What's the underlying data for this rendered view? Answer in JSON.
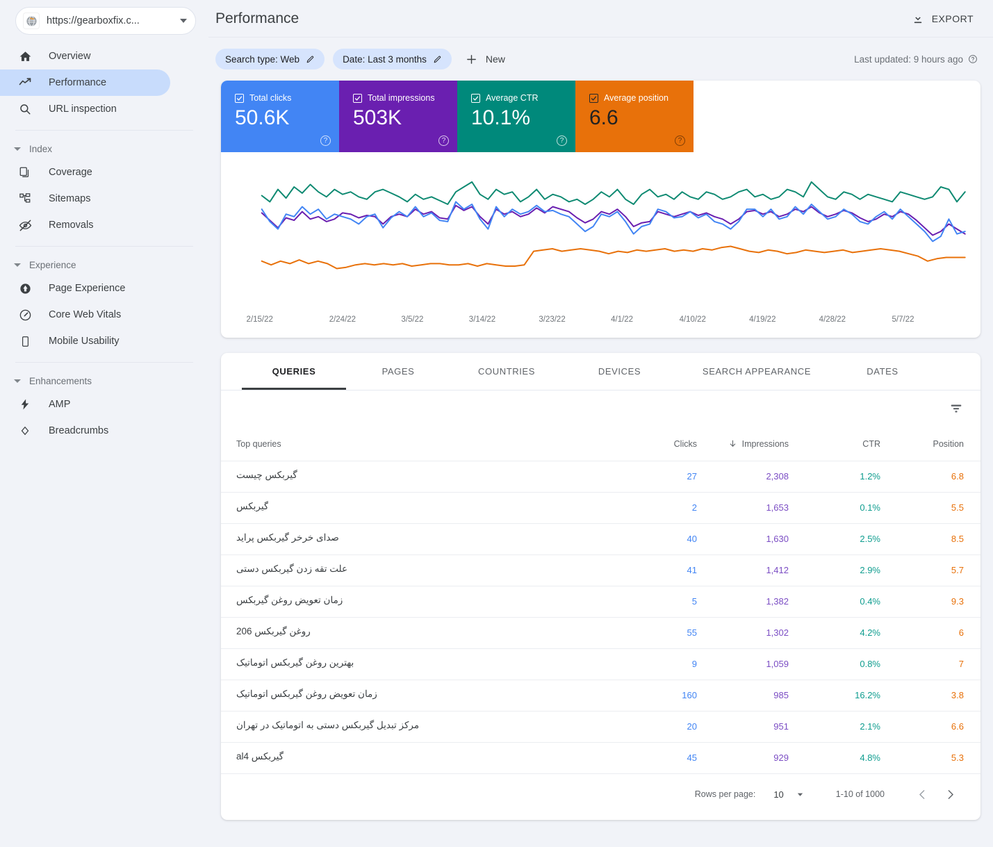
{
  "sidebar": {
    "property": {
      "url": "https://gearboxfix.c...",
      "favicon_icon": "site-favicon-icon",
      "dropdown_icon": "chevron-down-icon"
    },
    "items": [
      {
        "label": "Overview",
        "icon": "home-icon",
        "active": false
      },
      {
        "label": "Performance",
        "icon": "trending-up-icon",
        "active": true
      },
      {
        "label": "URL inspection",
        "icon": "search-icon",
        "active": false
      }
    ],
    "groups": [
      {
        "label": "Index",
        "icon": "triangle-down-icon",
        "items": [
          {
            "label": "Coverage",
            "icon": "pages-copy-icon"
          },
          {
            "label": "Sitemaps",
            "icon": "sitemap-icon"
          },
          {
            "label": "Removals",
            "icon": "eye-off-icon"
          }
        ]
      },
      {
        "label": "Experience",
        "icon": "triangle-down-icon",
        "items": [
          {
            "label": "Page Experience",
            "icon": "page-experience-icon"
          },
          {
            "label": "Core Web Vitals",
            "icon": "speedometer-icon"
          },
          {
            "label": "Mobile Usability",
            "icon": "mobile-phone-icon"
          }
        ]
      },
      {
        "label": "Enhancements",
        "icon": "triangle-down-icon",
        "items": [
          {
            "label": "AMP",
            "icon": "lightning-bolt-icon"
          },
          {
            "label": "Breadcrumbs",
            "icon": "breadcrumbs-icon"
          }
        ]
      }
    ]
  },
  "header": {
    "title": "Performance",
    "export_label": "EXPORT",
    "export_icon": "download-icon"
  },
  "filters": {
    "chips": [
      {
        "label": "Search type: Web",
        "icon": "pencil-icon"
      },
      {
        "label": "Date: Last 3 months",
        "icon": "pencil-icon"
      }
    ],
    "new_label": "New",
    "new_icon": "plus-icon",
    "last_updated": "Last updated: 9 hours ago",
    "help_icon": "help-circle-icon"
  },
  "metrics": [
    {
      "name": "Total clicks",
      "value": "50.6K",
      "color": "#4285F4",
      "checked": true,
      "dark_text": false,
      "help_icon": "help-circle-icon",
      "checkbox_icon": "checkbox-checked-icon"
    },
    {
      "name": "Total impressions",
      "value": "503K",
      "color": "#6A1FB0",
      "checked": true,
      "dark_text": false,
      "help_icon": "help-circle-icon",
      "checkbox_icon": "checkbox-checked-icon"
    },
    {
      "name": "Average CTR",
      "value": "10.1%",
      "color": "#00897B",
      "checked": true,
      "dark_text": false,
      "help_icon": "help-circle-icon",
      "checkbox_icon": "checkbox-checked-icon"
    },
    {
      "name": "Average position",
      "value": "6.6",
      "color": "#E8710A",
      "checked": true,
      "dark_text": true,
      "help_icon": "help-circle-icon",
      "checkbox_icon": "checkbox-checked-icon"
    }
  ],
  "chart_data": {
    "type": "line",
    "title": "",
    "xlabel": "",
    "ylabel": "",
    "grid": false,
    "legend": "metric-cards-above",
    "tick_labels": [
      "2/15/22",
      "2/24/22",
      "3/5/22",
      "3/14/22",
      "3/23/22",
      "4/1/22",
      "4/10/22",
      "4/19/22",
      "4/28/22",
      "5/7/22"
    ],
    "tick_positions_pct": [
      5.1,
      16.0,
      25.2,
      34.4,
      43.6,
      52.8,
      62.1,
      71.3,
      80.5,
      89.8
    ],
    "series": [
      {
        "name": "Total impressions",
        "color": "#6A1FB0",
        "values": [
          61,
          55,
          49,
          57,
          55,
          62,
          56,
          58,
          54,
          56,
          61,
          60,
          57,
          59,
          58,
          52,
          58,
          60,
          58,
          64,
          60,
          62,
          57,
          56,
          67,
          63,
          66,
          58,
          52,
          64,
          60,
          62,
          58,
          60,
          65,
          61,
          66,
          64,
          62,
          57,
          53,
          56,
          62,
          60,
          64,
          58,
          50,
          53,
          54,
          62,
          60,
          58,
          60,
          62,
          59,
          61,
          58,
          56,
          52,
          56,
          62,
          63,
          60,
          62,
          58,
          60,
          64,
          62,
          66,
          61,
          58,
          60,
          63,
          61,
          57,
          54,
          56,
          60,
          58,
          62,
          60,
          55,
          49,
          43,
          46,
          52,
          48,
          44
        ]
      },
      {
        "name": "Total clicks",
        "color": "#4285F4",
        "values": [
          64,
          54,
          48,
          60,
          58,
          66,
          60,
          64,
          56,
          60,
          58,
          56,
          52,
          58,
          60,
          49,
          57,
          62,
          58,
          66,
          58,
          61,
          55,
          54,
          70,
          64,
          68,
          56,
          48,
          66,
          58,
          64,
          60,
          62,
          67,
          62,
          63,
          60,
          58,
          52,
          46,
          50,
          60,
          58,
          62,
          54,
          44,
          50,
          52,
          64,
          62,
          57,
          58,
          62,
          57,
          60,
          54,
          52,
          48,
          54,
          64,
          64,
          58,
          64,
          56,
          58,
          66,
          60,
          68,
          62,
          56,
          58,
          64,
          60,
          54,
          52,
          58,
          62,
          56,
          64,
          58,
          52,
          46,
          38,
          42,
          56,
          44,
          46
        ]
      },
      {
        "name": "Average CTR",
        "color": "#0F8A72",
        "values": [
          75,
          70,
          80,
          73,
          82,
          77,
          84,
          78,
          74,
          80,
          76,
          78,
          74,
          72,
          78,
          80,
          77,
          74,
          70,
          76,
          72,
          74,
          71,
          68,
          78,
          82,
          86,
          76,
          72,
          80,
          76,
          78,
          70,
          74,
          80,
          72,
          76,
          74,
          70,
          72,
          68,
          72,
          78,
          74,
          80,
          72,
          68,
          76,
          80,
          74,
          76,
          72,
          78,
          74,
          72,
          78,
          76,
          72,
          74,
          78,
          80,
          74,
          76,
          72,
          74,
          80,
          78,
          74,
          86,
          80,
          74,
          72,
          78,
          76,
          72,
          76,
          74,
          72,
          70,
          78,
          76,
          74,
          72,
          74,
          82,
          80,
          70,
          78
        ]
      },
      {
        "name": "Average position",
        "color": "#E8710A",
        "values": [
          22,
          19,
          22,
          20,
          23,
          20,
          22,
          20,
          16,
          17,
          19,
          20,
          19,
          20,
          19,
          20,
          18,
          19,
          20,
          20,
          19,
          19,
          20,
          18,
          20,
          19,
          18,
          18,
          19,
          30,
          31,
          32,
          30,
          31,
          32,
          31,
          30,
          28,
          30,
          29,
          31,
          30,
          31,
          32,
          30,
          31,
          30,
          32,
          31,
          33,
          34,
          32,
          30,
          29,
          31,
          30,
          28,
          29,
          31,
          30,
          29,
          30,
          31,
          29,
          30,
          31,
          32,
          31,
          30,
          28,
          26,
          22,
          24,
          25,
          25,
          25
        ]
      }
    ]
  },
  "table": {
    "tabs": [
      {
        "label": "QUERIES",
        "active": true
      },
      {
        "label": "PAGES",
        "active": false
      },
      {
        "label": "COUNTRIES",
        "active": false
      },
      {
        "label": "DEVICES",
        "active": false
      },
      {
        "label": "SEARCH APPEARANCE",
        "active": false
      },
      {
        "label": "DATES",
        "active": false
      }
    ],
    "filter_icon": "filter-funnel-icon",
    "columns": {
      "query": "Top queries",
      "clicks": "Clicks",
      "impressions": "Impressions",
      "ctr": "CTR",
      "position": "Position"
    },
    "sort_icon": "arrow-down-icon",
    "sorted_column": "impressions",
    "rows": [
      {
        "query": "گیربکس چیست",
        "clicks": "27",
        "impressions": "2,308",
        "ctr": "1.2%",
        "position": "6.8"
      },
      {
        "query": "گیربکس",
        "clicks": "2",
        "impressions": "1,653",
        "ctr": "0.1%",
        "position": "5.5"
      },
      {
        "query": "صدای خرخر گیربکس پراید",
        "clicks": "40",
        "impressions": "1,630",
        "ctr": "2.5%",
        "position": "8.5"
      },
      {
        "query": "علت تقه زدن گیربکس دستی",
        "clicks": "41",
        "impressions": "1,412",
        "ctr": "2.9%",
        "position": "5.7"
      },
      {
        "query": "زمان تعویض روغن گیربکس",
        "clicks": "5",
        "impressions": "1,382",
        "ctr": "0.4%",
        "position": "9.3"
      },
      {
        "query": "روغن گیربکس 206",
        "clicks": "55",
        "impressions": "1,302",
        "ctr": "4.2%",
        "position": "6"
      },
      {
        "query": "بهترین روغن گیربکس اتوماتیک",
        "clicks": "9",
        "impressions": "1,059",
        "ctr": "0.8%",
        "position": "7"
      },
      {
        "query": "زمان تعویض روغن گیربکس اتوماتیک",
        "clicks": "160",
        "impressions": "985",
        "ctr": "16.2%",
        "position": "3.8"
      },
      {
        "query": "مرکز تبدیل گیربکس دستی به اتوماتیک در تهران",
        "clicks": "20",
        "impressions": "951",
        "ctr": "2.1%",
        "position": "6.6"
      },
      {
        "query": "گیربکس al4",
        "clicks": "45",
        "impressions": "929",
        "ctr": "4.8%",
        "position": "5.3"
      }
    ],
    "footer": {
      "rows_per_page_label": "Rows per page:",
      "rows_per_page_value": "10",
      "rows_per_page_icon": "chevron-down-icon",
      "range": "1-10 of 1000",
      "prev_icon": "chevron-left-icon",
      "next_icon": "chevron-right-icon"
    }
  }
}
